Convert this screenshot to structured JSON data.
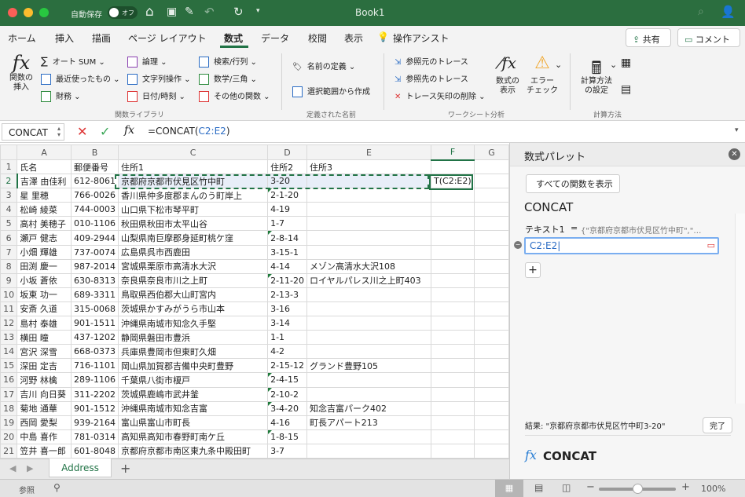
{
  "title": {
    "autosave": "自動保存",
    "toggle": "オフ",
    "book": "Book1"
  },
  "tabs": [
    "ホーム",
    "挿入",
    "描画",
    "ページ レイアウト",
    "数式",
    "データ",
    "校閲",
    "表示",
    "操作アシスト"
  ],
  "share": "共有",
  "comment": "コメント",
  "ribbon": {
    "insert_fn": "関数の\n挿入",
    "lib": [
      "オート SUM",
      "最近使ったもの",
      "財務",
      "論理",
      "文字列操作",
      "日付/時刻",
      "検索/行列",
      "数学/三角",
      "その他の関数"
    ],
    "lib_group": "関数ライブラリ",
    "names": [
      "名前の定義",
      "選択範囲から作成"
    ],
    "names_group": "定義された名前",
    "audit": [
      "参照元のトレース",
      "参照先のトレース",
      "トレース矢印の削除"
    ],
    "show_formulas": "数式の\n表示",
    "error_check": "エラー\nチェック",
    "audit_group": "ワークシート分析",
    "calc_options": "計算方法\nの設定",
    "calc_group": "計算方法"
  },
  "formula_bar": {
    "name_box": "CONCAT",
    "formula_prefix": "=CONCAT(",
    "formula_ref": "C2:E2",
    "formula_suffix": ")"
  },
  "grid": {
    "columns": [
      "A",
      "B",
      "C",
      "D",
      "E",
      "F",
      "G"
    ],
    "rows": [
      [
        "氏名",
        "郵便番号",
        "住所1",
        "住所2",
        "住所3",
        "",
        ""
      ],
      [
        "吉澤 由佳利",
        "612-8061",
        "京都府京都市伏見区竹中町",
        "3-20",
        "",
        "T(C2:E2)",
        ""
      ],
      [
        "星 里穂",
        "766-0026",
        "香川県仲多度郡まんのう町岸上",
        "2-1-20",
        "",
        "",
        ""
      ],
      [
        "松崎 綾菜",
        "744-0003",
        "山口県下松市琴平町",
        "4-19",
        "",
        "",
        ""
      ],
      [
        "高村 美穂子",
        "010-1106",
        "秋田県秋田市太平山谷",
        "1-7",
        "",
        "",
        ""
      ],
      [
        "瀬戸 健志",
        "409-2944",
        "山梨県南巨摩郡身延町桃ケ窪",
        "2-8-14",
        "",
        "",
        ""
      ],
      [
        "小畑 輝雄",
        "737-0074",
        "広島県呉市西鹿田",
        "3-15-1",
        "",
        "",
        ""
      ],
      [
        "田渕 慶一",
        "987-2014",
        "宮城県栗原市高清水大沢",
        "4-14",
        "メゾン高清水大沢108",
        "",
        ""
      ],
      [
        "小坂 蒼依",
        "630-8313",
        "奈良県奈良市川之上町",
        "2-11-20",
        "ロイヤルパレス川之上町403",
        "",
        ""
      ],
      [
        "坂東 功一",
        "689-3311",
        "鳥取県西伯郡大山町宮内",
        "2-13-3",
        "",
        "",
        ""
      ],
      [
        "安斎 久道",
        "315-0068",
        "茨城県かすみがうら市山本",
        "3-16",
        "",
        "",
        ""
      ],
      [
        "島村 泰雄",
        "901-1511",
        "沖縄県南城市知念久手堅",
        "3-14",
        "",
        "",
        ""
      ],
      [
        "横田 瞳",
        "437-1202",
        "静岡県磐田市豊浜",
        "1-1",
        "",
        "",
        ""
      ],
      [
        "宮沢 深雪",
        "668-0373",
        "兵庫県豊岡市但東町久畑",
        "4-2",
        "",
        "",
        ""
      ],
      [
        "深田 定吉",
        "716-1101",
        "岡山県加賀郡吉備中央町豊野",
        "2-15-12",
        "グランド豊野105",
        "",
        ""
      ],
      [
        "河野 林檎",
        "289-1106",
        "千葉県八街市榎戸",
        "2-4-15",
        "",
        "",
        ""
      ],
      [
        "吉川 向日葵",
        "311-2202",
        "茨城県鹿嶋市武井釜",
        "2-10-2",
        "",
        "",
        ""
      ],
      [
        "菊地 通華",
        "901-1512",
        "沖縄県南城市知念吉富",
        "3-4-20",
        "知念吉富パーク402",
        "",
        ""
      ],
      [
        "西岡 愛梨",
        "939-2164",
        "富山県富山市町長",
        "4-16",
        "町長アパート213",
        "",
        ""
      ],
      [
        "中島 喜作",
        "781-0314",
        "高知県高知市春野町南ケ丘",
        "1-8-15",
        "",
        "",
        ""
      ],
      [
        "笠井 喜一郎",
        "601-8048",
        "京都府京都市南区東九条中殿田町",
        "3-7",
        "",
        "",
        ""
      ]
    ],
    "text_flag_rows": [
      3,
      6,
      9,
      16,
      17,
      18,
      20
    ]
  },
  "sheet_tab": "Address",
  "pane": {
    "title": "数式パレット",
    "back": "すべての関数を表示",
    "fn": "CONCAT",
    "arg_label": "テキスト1",
    "arg_eq": "=",
    "arg_preview": "{\"京都府京都市伏見区竹中町\",\"…",
    "arg_value": "C2:E2",
    "result": "結果: \"京都府京都市伏見区竹中町3-20\"",
    "done": "完了",
    "help_fn": "CONCAT",
    "help_fx": "fx"
  },
  "status": {
    "mode": "参照",
    "zoom": "100%",
    "zoom_level": 100
  }
}
